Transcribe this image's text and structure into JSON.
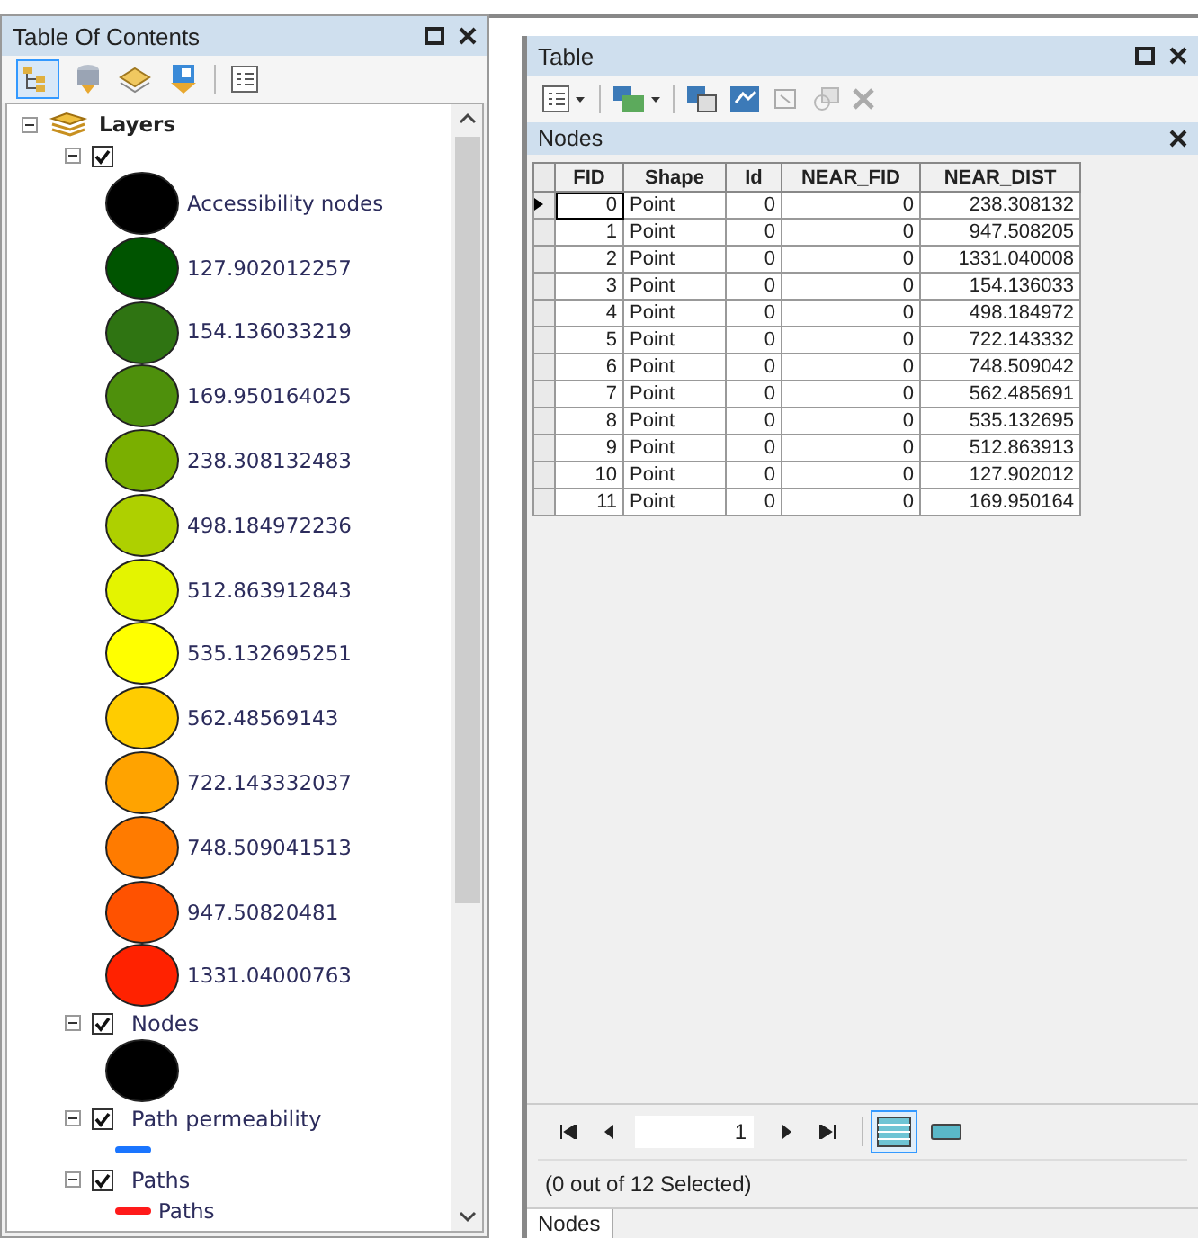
{
  "toc": {
    "title": "Table Of Contents",
    "group": {
      "name": "Layers",
      "expanded": true
    },
    "layers": [
      {
        "checked": true,
        "expanded": true,
        "legend": [
          {
            "kind": "circle",
            "color": "#000000",
            "label": "Accessibility nodes"
          },
          {
            "kind": "circle",
            "color": "#005400",
            "label": "127.902012257"
          },
          {
            "kind": "circle",
            "color": "#2f7412",
            "label": "154.136033219"
          },
          {
            "kind": "circle",
            "color": "#4e900c",
            "label": "169.950164025"
          },
          {
            "kind": "circle",
            "color": "#7aaf00",
            "label": "238.308132483"
          },
          {
            "kind": "circle",
            "color": "#aed000",
            "label": "498.184972236"
          },
          {
            "kind": "circle",
            "color": "#e4f400",
            "label": "512.863912843"
          },
          {
            "kind": "circle",
            "color": "#ffff00",
            "label": "535.132695251"
          },
          {
            "kind": "circle",
            "color": "#ffcc00",
            "label": "562.48569143"
          },
          {
            "kind": "circle",
            "color": "#ffa300",
            "label": "722.143332037"
          },
          {
            "kind": "circle",
            "color": "#ff7b00",
            "label": "748.509041513"
          },
          {
            "kind": "circle",
            "color": "#ff5200",
            "label": "947.50820481"
          },
          {
            "kind": "circle",
            "color": "#ff2200",
            "label": "1331.04000763"
          }
        ]
      },
      {
        "name": "Nodes",
        "checked": true,
        "expanded": true,
        "legend": [
          {
            "kind": "circle",
            "color": "#000000"
          }
        ]
      },
      {
        "name": "Path permeability",
        "checked": true,
        "expanded": true,
        "legend": [
          {
            "kind": "line",
            "color": "#1a75ff"
          }
        ]
      },
      {
        "name": "Paths",
        "checked": true,
        "expanded": true,
        "legend": [
          {
            "kind": "line",
            "color": "#ff1a1a",
            "label": "Paths"
          }
        ]
      }
    ]
  },
  "table": {
    "title": "Table",
    "subtitle": "Nodes",
    "columns": [
      "FID",
      "Shape",
      "Id",
      "NEAR_FID",
      "NEAR_DIST"
    ],
    "rows": [
      {
        "current": true,
        "cells": [
          "0",
          "Point",
          "0",
          "0",
          "238.308132"
        ]
      },
      {
        "current": false,
        "cells": [
          "1",
          "Point",
          "0",
          "0",
          "947.508205"
        ]
      },
      {
        "current": false,
        "cells": [
          "2",
          "Point",
          "0",
          "0",
          "1331.040008"
        ]
      },
      {
        "current": false,
        "cells": [
          "3",
          "Point",
          "0",
          "0",
          "154.136033"
        ]
      },
      {
        "current": false,
        "cells": [
          "4",
          "Point",
          "0",
          "0",
          "498.184972"
        ]
      },
      {
        "current": false,
        "cells": [
          "5",
          "Point",
          "0",
          "0",
          "722.143332"
        ]
      },
      {
        "current": false,
        "cells": [
          "6",
          "Point",
          "0",
          "0",
          "748.509042"
        ]
      },
      {
        "current": false,
        "cells": [
          "7",
          "Point",
          "0",
          "0",
          "562.485691"
        ]
      },
      {
        "current": false,
        "cells": [
          "8",
          "Point",
          "0",
          "0",
          "535.132695"
        ]
      },
      {
        "current": false,
        "cells": [
          "9",
          "Point",
          "0",
          "0",
          "512.863913"
        ]
      },
      {
        "current": false,
        "cells": [
          "10",
          "Point",
          "0",
          "0",
          "127.902012"
        ]
      },
      {
        "current": false,
        "cells": [
          "11",
          "Point",
          "0",
          "0",
          "169.950164"
        ]
      }
    ],
    "record": "1",
    "views": [
      {
        "kind": "all",
        "selected": true
      },
      {
        "kind": "selected_only",
        "selected": false
      }
    ],
    "status": "(0 out of 12 Selected)",
    "tabs": [
      {
        "label": "Nodes",
        "selected": true
      }
    ]
  }
}
